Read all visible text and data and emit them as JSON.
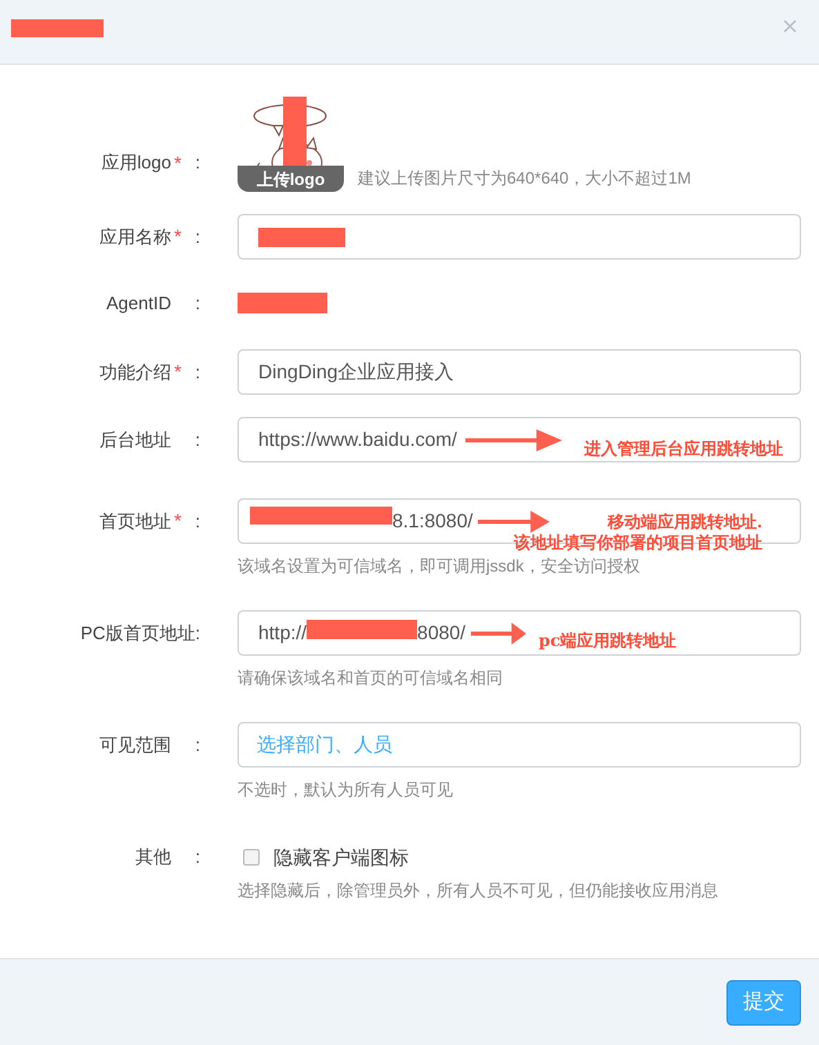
{
  "dialog": {
    "title_redacted": true
  },
  "fields": [
    {
      "kind": "logo",
      "label": "应用logo",
      "asterisk": "*",
      "colon": ":",
      "upload_label": "上传logo",
      "hint": "建议上传图片尺寸为640*640，大小不超过1M",
      "redacted": true
    },
    {
      "kind": "input",
      "label": "应用名称",
      "asterisk": "*",
      "colon": ":",
      "segments": [
        {
          "kind": "redacted"
        }
      ]
    },
    {
      "kind": "plain",
      "label": "AgentID",
      "colon": ":",
      "segments": [
        {
          "kind": "redacted"
        }
      ]
    },
    {
      "kind": "input",
      "label": "功能介绍",
      "asterisk": "*",
      "colon": ":",
      "segments": [
        {
          "kind": "text",
          "text": "DingDing企业应用接入"
        }
      ]
    },
    {
      "kind": "input",
      "label": "后台地址",
      "colon": ":",
      "segments": [
        {
          "kind": "text",
          "text": "https://www.baidu.com/"
        }
      ],
      "annotation": [
        "进入管理后台应用跳转地址"
      ]
    },
    {
      "kind": "input",
      "label": "首页地址",
      "asterisk": "*",
      "colon": ":",
      "segments": [
        {
          "kind": "redacted"
        },
        {
          "kind": "text",
          "text": "8.1:8080/"
        }
      ],
      "hint": "该域名设置为可信域名，即可调用jssdk，安全访问授权",
      "annotation": [
        "移动端应用跳转地址.",
        "该地址填写你部署的项目首页地址"
      ]
    },
    {
      "kind": "input",
      "label": "PC版首页地址:",
      "segments": [
        {
          "kind": "text",
          "text": "http://"
        },
        {
          "kind": "redacted"
        },
        {
          "kind": "text",
          "text": "8080/"
        }
      ],
      "hint": "请确保该域名和首页的可信域名相同",
      "annotation": [
        "pc端应用跳转地址"
      ]
    },
    {
      "kind": "picker",
      "label": "可见范围",
      "colon": ":",
      "placeholder": "选择部门、人员",
      "hint": "不选时，默认为所有人员可见"
    },
    {
      "kind": "checkbox",
      "label": "其他",
      "colon": ":",
      "option": "隐藏客户端图标",
      "checked": false,
      "hint": "选择隐藏后，除管理员外，所有人员不可见，但仍能接收应用消息"
    }
  ],
  "submit": "提交"
}
